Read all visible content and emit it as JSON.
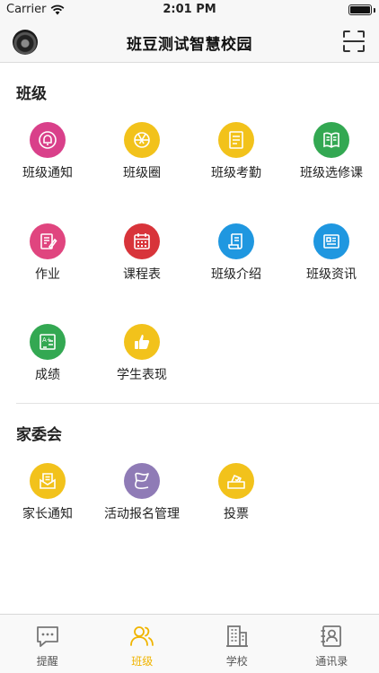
{
  "status": {
    "carrier": "Carrier",
    "time": "2:01 PM"
  },
  "nav": {
    "title": "班豆测试智慧校园"
  },
  "sections": [
    {
      "title": "班级"
    },
    {
      "title": "家委会"
    }
  ],
  "class_items": [
    {
      "label": "班级通知",
      "icon": "bell-icon",
      "color": "#d9408a"
    },
    {
      "label": "班级圈",
      "icon": "aperture-icon",
      "color": "#f2c21b"
    },
    {
      "label": "班级考勤",
      "icon": "attendance-icon",
      "color": "#f2c21b"
    },
    {
      "label": "班级选修课",
      "icon": "book-icon",
      "color": "#33a852"
    },
    {
      "label": "作业",
      "icon": "homework-icon",
      "color": "#e0457f"
    },
    {
      "label": "课程表",
      "icon": "calendar-icon",
      "color": "#d8343a"
    },
    {
      "label": "班级介绍",
      "icon": "scroll-icon",
      "color": "#1f97e0"
    },
    {
      "label": "班级资讯",
      "icon": "news-icon",
      "color": "#1f97e0"
    },
    {
      "label": "成绩",
      "icon": "grade-icon",
      "color": "#33a852"
    },
    {
      "label": "学生表现",
      "icon": "thumbs-up-icon",
      "color": "#f2c21b"
    }
  ],
  "committee_items": [
    {
      "label": "家长通知",
      "icon": "mail-icon",
      "color": "#f2c21b"
    },
    {
      "label": "活动报名管理",
      "icon": "flag-icon",
      "color": "#8f7bb6"
    },
    {
      "label": "投票",
      "icon": "ballot-icon",
      "color": "#f2c21b"
    }
  ],
  "tabs": [
    {
      "label": "提醒",
      "icon": "chat-icon",
      "active": false
    },
    {
      "label": "班级",
      "icon": "people-icon",
      "active": true
    },
    {
      "label": "学校",
      "icon": "building-icon",
      "active": false
    },
    {
      "label": "通讯录",
      "icon": "contacts-icon",
      "active": false
    }
  ],
  "colors": {
    "accent": "#f0b400",
    "text": "#222222"
  }
}
